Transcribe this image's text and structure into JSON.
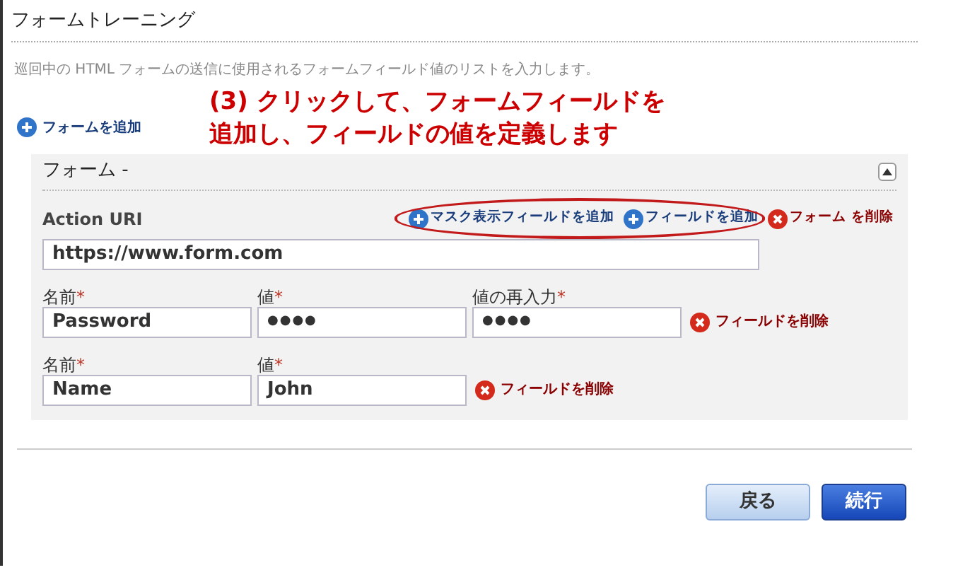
{
  "title": "フォームトレーニング",
  "description": "巡回中の HTML フォームの送信に使用されるフォームフィールド値のリストを入力します。",
  "add_form_link": "フォームを追加",
  "annotation": [
    "(3) クリックして、フォームフィールドを",
    "追加し、フィールドの値を定義します"
  ],
  "form": {
    "title": "フォーム -",
    "expanded": true,
    "action_label": "Action URI",
    "action_value": "https://www.form.com",
    "actions": [
      {
        "kind": "add",
        "label": "マスク表示フィールドを追加"
      },
      {
        "kind": "add",
        "label": "フィールドを追加"
      },
      {
        "kind": "remove",
        "label": "フォーム を削除"
      }
    ],
    "fields": [
      {
        "name_label": "名前",
        "value_label": "値",
        "confirm_label": "値の再入力",
        "name": "Password",
        "value": "●●●●",
        "confirm": "●●●●",
        "masked": true,
        "remove": "フィールドを削除"
      },
      {
        "name_label": "名前",
        "value_label": "値",
        "name": "Name",
        "value": "John",
        "masked": false,
        "remove": "フィールドを削除"
      }
    ],
    "required_mark": "*"
  },
  "buttons": [
    {
      "kind": "secondary",
      "label": "戻る"
    },
    {
      "kind": "primary",
      "label": "続行"
    }
  ]
}
